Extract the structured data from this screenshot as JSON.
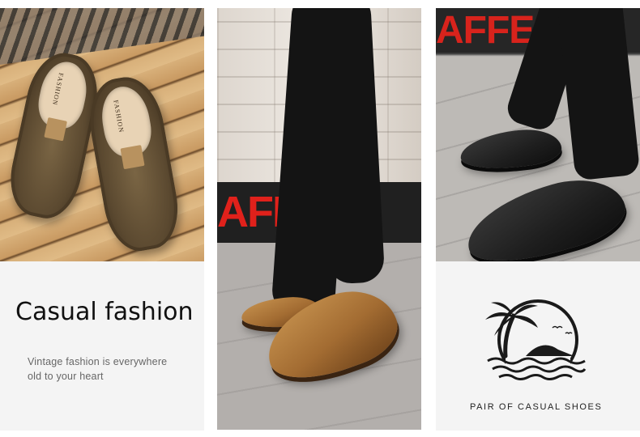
{
  "panels": {
    "left": {
      "title": "Casual fashion",
      "subtitle_line1": "Vintage fashion is everywhere",
      "subtitle_line2": "old to your heart",
      "shoe_brand_left": "FASHION",
      "shoe_brand_right": "FASHION"
    },
    "middle": {
      "sign_text": "AFFE P SC"
    },
    "right": {
      "sign_text": "AFFE P",
      "caption": "PAIR OF CASUAL SHOES",
      "logo_icon": "palm-tree-island-icon"
    }
  },
  "colors": {
    "sign_red": "#e0211b",
    "caption_bg": "#f4f4f4"
  }
}
